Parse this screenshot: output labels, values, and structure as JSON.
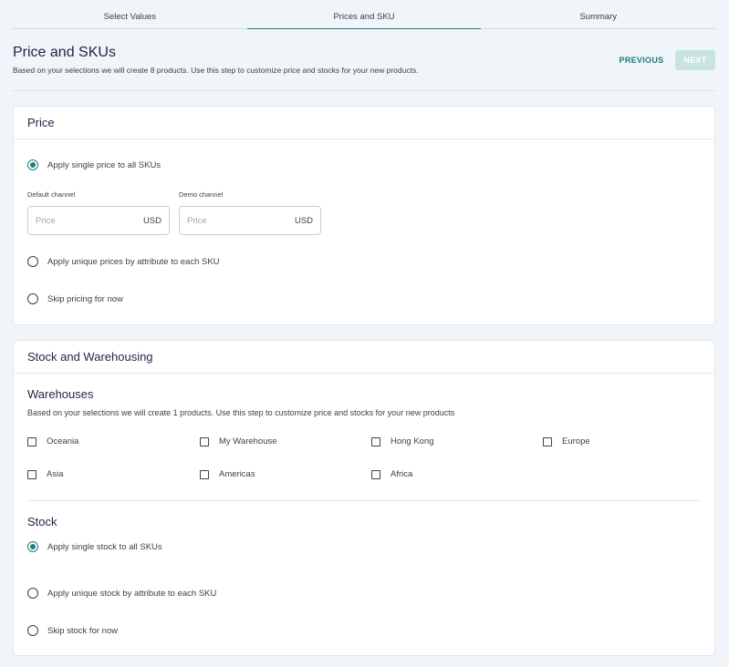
{
  "stepper": {
    "steps": [
      {
        "label": "Select Values"
      },
      {
        "label": "Prices and SKU"
      },
      {
        "label": "Summary"
      }
    ]
  },
  "header": {
    "title": "Price and SKUs",
    "description": "Based on your selections we will create 8 products. Use this step to customize price and stocks for your new products.",
    "previous_label": "PREVIOUS",
    "next_label": "NEXT"
  },
  "price_card": {
    "title": "Price",
    "options": [
      {
        "label": "Apply single price to all SKUs",
        "checked": true
      },
      {
        "label": "Apply unique prices by attribute to each SKU",
        "checked": false
      },
      {
        "label": "Skip pricing for now",
        "checked": false
      }
    ],
    "channels": [
      {
        "label": "Default channel",
        "placeholder": "Price",
        "currency": "USD"
      },
      {
        "label": "Demo channel",
        "placeholder": "Price",
        "currency": "USD"
      }
    ]
  },
  "stock_card": {
    "title": "Stock and Warehousing",
    "warehouses_title": "Warehouses",
    "warehouses_description": "Based on your selections we will create 1 products. Use this step to customize price and stocks for your new products",
    "warehouses": [
      {
        "label": "Oceania",
        "checked": false
      },
      {
        "label": "My Warehouse",
        "checked": false
      },
      {
        "label": "Hong Kong",
        "checked": false
      },
      {
        "label": "Europe",
        "checked": false
      },
      {
        "label": "Asia",
        "checked": false
      },
      {
        "label": "Americas",
        "checked": false
      },
      {
        "label": "Africa",
        "checked": false
      }
    ],
    "stock_title": "Stock",
    "options": [
      {
        "label": "Apply single stock to all SKUs",
        "checked": true
      },
      {
        "label": "Apply unique stock by attribute to each SKU",
        "checked": false
      },
      {
        "label": "Skip stock for now",
        "checked": false
      }
    ]
  },
  "colors": {
    "accent": "#1b7f79",
    "next_disabled": "#c9e3e3",
    "background": "#eff5f8"
  }
}
